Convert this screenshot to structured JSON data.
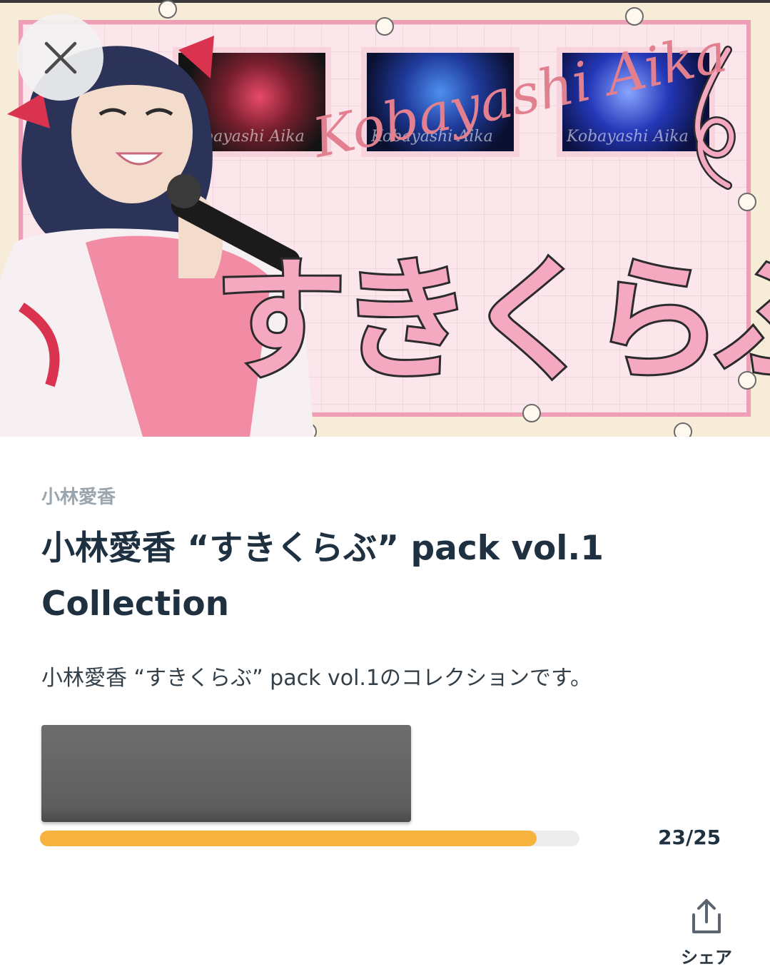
{
  "banner": {
    "script_name": "Kobayashi Aika",
    "big_title": "すきくらぶ",
    "photo_captions": [
      "Kobayashi Aika",
      "Kobayashi Aika",
      "Kobayashi Aika"
    ]
  },
  "header": {
    "close_icon": "close-icon"
  },
  "collection": {
    "creator": "小林愛香",
    "title": "小林愛香 “すきくらぶ” pack vol.1 Collection",
    "description": "小林愛香 “すきくらぶ” pack vol.1のコレクションです。"
  },
  "progress": {
    "owned": 23,
    "total": 25,
    "text": "23/25",
    "fraction": 0.92
  },
  "share": {
    "label": "シェア",
    "icon": "share-icon"
  },
  "colors": {
    "progress_fill": "#f8b33e",
    "progress_track": "#ececec",
    "title_text": "#1f3140",
    "creator_text": "#9aa5ad",
    "banner_pink": "#ee9fb5"
  }
}
